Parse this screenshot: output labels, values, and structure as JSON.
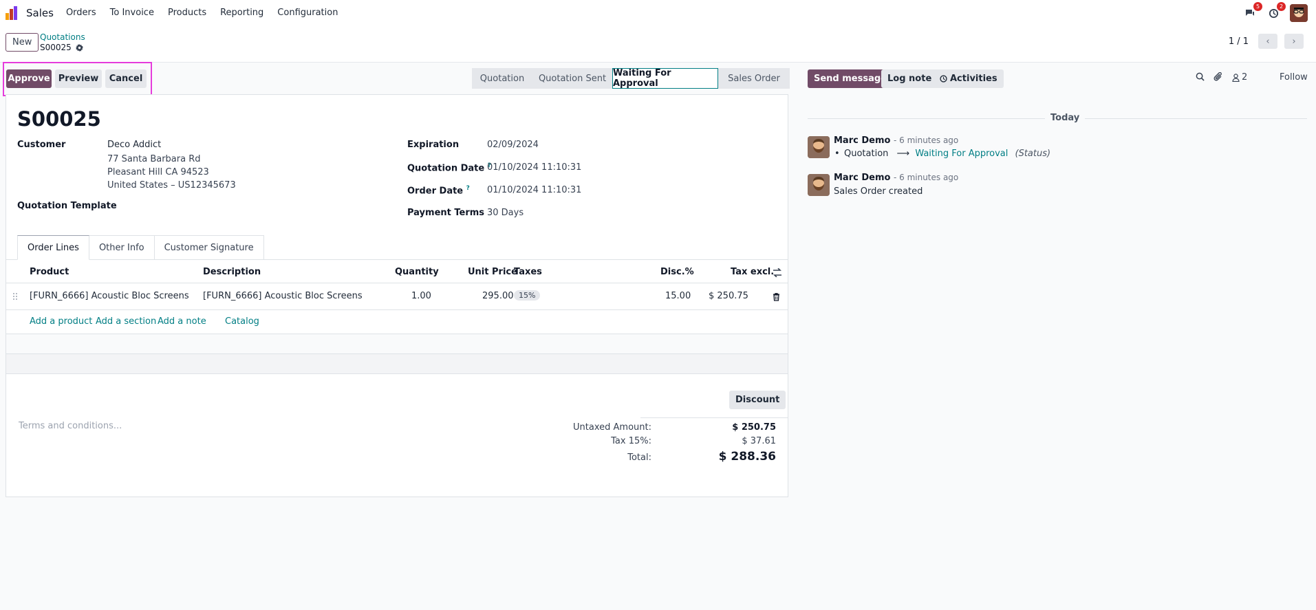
{
  "navbar": {
    "app_name": "Sales",
    "menu": [
      "Orders",
      "To Invoice",
      "Products",
      "Reporting",
      "Configuration"
    ],
    "messages_count": "5",
    "activities_count": "2"
  },
  "control": {
    "new_label": "New",
    "breadcrumb_parent": "Quotations",
    "breadcrumb_current": "S00025",
    "pager": "1 / 1"
  },
  "actions": {
    "approve": "Approve",
    "preview": "Preview",
    "cancel": "Cancel"
  },
  "stages": [
    "Quotation",
    "Quotation Sent",
    "Waiting For Approval",
    "Sales Order"
  ],
  "active_stage": "Waiting For Approval",
  "form": {
    "name": "S00025",
    "customer_label": "Customer",
    "customer_name": "Deco Addict",
    "customer_addr1": "77 Santa Barbara Rd",
    "customer_addr2": "Pleasant Hill CA 94523",
    "customer_addr3": "United States – US12345673",
    "template_label": "Quotation Template",
    "expiration_label": "Expiration",
    "expiration_value": "02/09/2024",
    "quotation_date_label": "Quotation Date",
    "quotation_date_value": "01/10/2024 11:10:31",
    "order_date_label": "Order Date",
    "order_date_value": "01/10/2024 11:10:31",
    "payment_terms_label": "Payment Terms",
    "payment_terms_value": "30 Days",
    "help_mark": "?"
  },
  "tabs": [
    "Order Lines",
    "Other Info",
    "Customer Signature"
  ],
  "table": {
    "headers": {
      "product": "Product",
      "description": "Description",
      "quantity": "Quantity",
      "unit_price": "Unit Price",
      "taxes": "Taxes",
      "disc": "Disc.%",
      "tax_excl": "Tax excl."
    },
    "row": {
      "product": "[FURN_6666] Acoustic Bloc Screens",
      "description": "[FURN_6666] Acoustic Bloc Screens",
      "quantity": "1.00",
      "unit_price": "295.00",
      "taxes": "15%",
      "disc": "15.00",
      "tax_excl": "$ 250.75"
    },
    "add_product": "Add a product",
    "add_section": "Add a section",
    "add_note": "Add a note",
    "catalog": "Catalog"
  },
  "totals": {
    "discount_label": "Discount",
    "terms_placeholder": "Terms and conditions...",
    "untaxed_label": "Untaxed Amount:",
    "untaxed_value": "$ 250.75",
    "tax_label": "Tax 15%:",
    "tax_value": "$ 37.61",
    "total_label": "Total:",
    "total_value": "$ 288.36"
  },
  "chatter": {
    "send_message": "Send message",
    "log_note": "Log note",
    "activities": "Activities",
    "followers_count": "2",
    "follow": "Follow",
    "today": "Today",
    "messages": [
      {
        "author": "Marc Demo",
        "time": "- 6 minutes ago",
        "old_value": "Quotation",
        "new_value": "Waiting For Approval",
        "field": "(Status)"
      },
      {
        "author": "Marc Demo",
        "time": "- 6 minutes ago",
        "body": "Sales Order created"
      }
    ]
  }
}
